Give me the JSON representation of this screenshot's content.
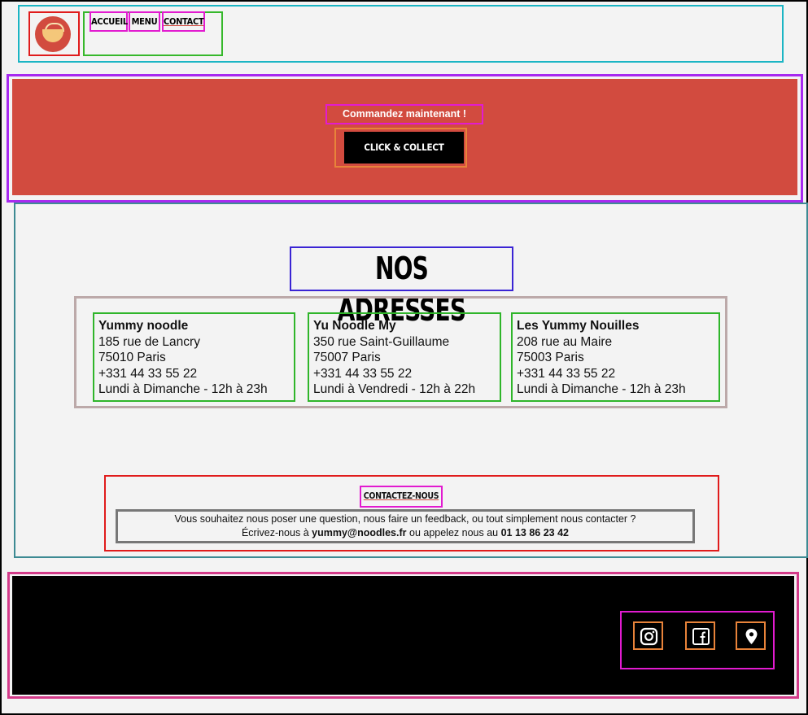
{
  "nav": {
    "items": [
      {
        "label": "ACCUEIL"
      },
      {
        "label": "MENU"
      },
      {
        "label": "CONTACT"
      }
    ]
  },
  "hero": {
    "title": "Commandez maintenant !",
    "cta_label": "CLICK & COLLECT"
  },
  "addresses": {
    "title": "NOS ADRESSES",
    "cards": [
      {
        "name": "Yummy noodle",
        "street": "185 rue de Lancry",
        "city": "75010 Paris",
        "phone": "+331 44 33 55 22",
        "hours": "Lundi à Dimanche - 12h à 23h"
      },
      {
        "name": "Yu Noodle My",
        "street": "350 rue Saint-Guillaume",
        "city": "75007 Paris",
        "phone": "+331 44 33 55 22",
        "hours": "Lundi à Vendredi - 12h à 22h"
      },
      {
        "name": "Les Yummy Nouilles",
        "street": "208 rue au Maire",
        "city": "75003 Paris",
        "phone": "+331 44 33 55 22",
        "hours": "Lundi à Dimanche - 12h à 23h"
      }
    ]
  },
  "contact": {
    "title": "CONTACTEZ-NOUS",
    "line1": "Vous souhaitez nous poser une question, nous faire un feedback, ou tout simplement nous contacter ?",
    "line2_pre": "Écrivez-nous à ",
    "email": "yummy@noodles.fr",
    "line2_mid": " ou appelez nous au ",
    "phone": "01 13 86 23 42"
  },
  "footer": {
    "social": [
      {
        "icon": "instagram-icon"
      },
      {
        "icon": "facebook-icon"
      },
      {
        "icon": "location-pin-icon"
      }
    ]
  },
  "colors": {
    "brand_red": "#d24b3f",
    "page_bg": "#f3f3f3",
    "footer_bg": "#000000"
  }
}
